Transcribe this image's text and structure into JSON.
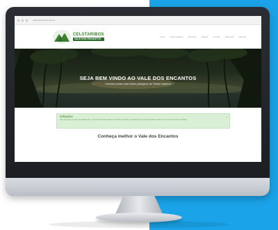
{
  "browser": {
    "url": "valedosencantos.com.br"
  },
  "site": {
    "logo_name": "CELSTARIBOS",
    "logo_tagline": "VALE DOS ENCANTOS",
    "nav": [
      {
        "label": "Início"
      },
      {
        "label": "Acomodações"
      },
      {
        "label": "Passeios"
      },
      {
        "label": "Galeria"
      },
      {
        "label": "Contato"
      },
      {
        "label": "Reservas"
      },
      {
        "label": "Idiomas"
      }
    ],
    "hero_title": "SEJA BEM VINDO AO VALE DOS ENCANTOS",
    "hero_subtitle": "Circuitos pelas mais belas paisagens de Santa Catarina",
    "alert_title": "ATENÇÃO!",
    "alert_text": "Este site está em fase de atualização, no mês atual ainda estamos incluindo conteúdos. Agradecemos a compreensão de todos e em breve teremos novidades.",
    "section_title": "Conheça melhor o Vale dos Encantos"
  },
  "colors": {
    "accent_blue": "#1aa3e8",
    "logo_green": "#3d7e2e",
    "alert_bg": "#d9f0d7"
  }
}
